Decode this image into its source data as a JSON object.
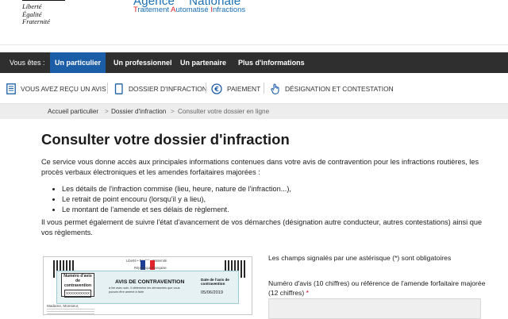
{
  "header": {
    "republic_motto": [
      "Liberté",
      "Égalité",
      "Fraternité"
    ],
    "agency_name_line1": [
      "Agence",
      "Nationale"
    ],
    "agency_name_line2": {
      "t": "T",
      "rest1": "raitement ",
      "a": "A",
      "rest2": "utomatisé ",
      "i": "I",
      "rest3": "nfractions"
    }
  },
  "audience_bar": {
    "label": "Vous êtes :",
    "tabs": [
      {
        "label": "Un particulier",
        "active": true
      },
      {
        "label": "Un professionnel",
        "active": false
      },
      {
        "label": "Un partenaire",
        "active": false
      },
      {
        "label": "Plus d'informations",
        "active": false
      }
    ]
  },
  "service_nav": {
    "items": [
      {
        "label": "VOUS AVEZ REÇU UN AVIS",
        "icon": "document-list-icon"
      },
      {
        "label": "DOSSIER D'INFRACTION",
        "icon": "folder-icon"
      },
      {
        "label": "PAIEMENT",
        "icon": "euro-icon"
      },
      {
        "label": "DÉSIGNATION ET CONTESTATION",
        "icon": "hand-pointer-icon"
      }
    ]
  },
  "breadcrumb": {
    "items": [
      "Accueil particulier",
      "Dossier d'infraction",
      "Consulter votre dossier en ligne"
    ],
    "separator": ">"
  },
  "main": {
    "title": "Consulter votre dossier d'infraction",
    "intro": "Ce service vous donne accès aux principales informations contenues dans votre avis de contravention pour les infractions routières, les procès verbaux électroniques et les amendes forfaitaires majorées :",
    "bullets": [
      "Les détails de l'infraction commise (lieu, heure, nature de l'infraction...),",
      "Le retrait de point encouru (lorsqu'il y a lieu),",
      "Le montant de l'amende et ses délais de règlement."
    ],
    "outro": "Il vous permet également de suivre l'état d'avancement de vos démarches (désignation autre conducteur, autres contestations) ainsi que vos règlements."
  },
  "avis_image": {
    "header_small_left": "Liberté • Égalité • Fraternité",
    "header_small_right": "République Française",
    "numbox_label": "Numéro d'avis de contravention",
    "numbox_value": "XXXXXXXXXX",
    "title": "AVIS DE CONTRAVENTION",
    "subtitle": "à lire avec soin. Il détermine les démarches que vous pouvez être amené à faire",
    "date_label": "Date de l'avis de contravention",
    "date_value": "05/06/2019",
    "greeting": "Madame, Monsieur,"
  },
  "form": {
    "required_note": "Les champs signalés par une astérisque (*) sont obligatoires",
    "field_label": "Numéro d'avis (10 chiffres) ou référence de l'amende forfaitaire majorée (12 chiffres)",
    "required_mark": "*",
    "field_value": ""
  },
  "colors": {
    "audience_bar_bg": "#2f2f2f",
    "active_tab_bg": "#1c5da8",
    "brand_blue": "#1b6fb3",
    "brand_red": "#e2232b",
    "breadcrumb_bg": "#ededed",
    "required_red": "#d0021b"
  }
}
